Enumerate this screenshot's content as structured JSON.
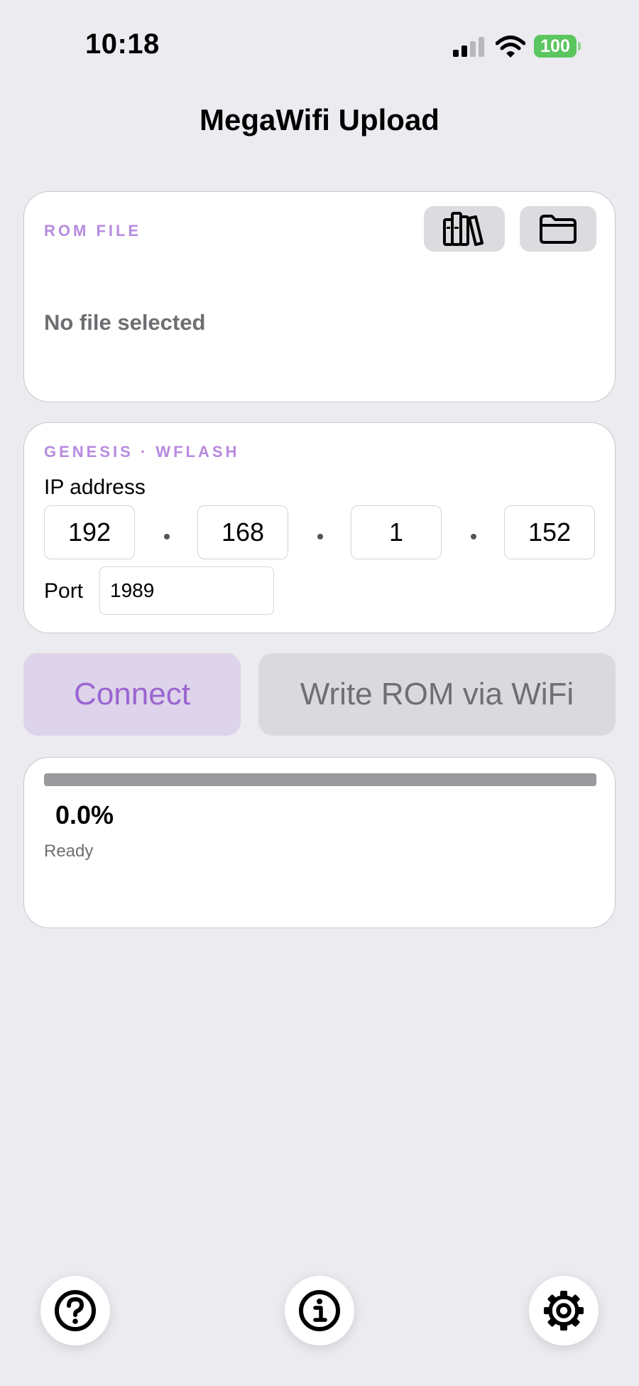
{
  "status_bar": {
    "time": "10:18",
    "battery": "100"
  },
  "nav": {
    "title": "MegaWifi Upload"
  },
  "rom_card": {
    "section_label": "ROM FILE",
    "file_status": "No file selected",
    "library_icon": "books-library-icon",
    "folder_icon": "folder-icon"
  },
  "network_card": {
    "section_label": "GENESIS · WFLASH",
    "ip_label": "IP address",
    "ip_octets": [
      "192",
      "168",
      "1",
      "152"
    ],
    "port_label": "Port",
    "port_value": "1989"
  },
  "actions": {
    "connect_label": "Connect",
    "write_label": "Write ROM via WiFi"
  },
  "progress": {
    "fraction": 0.0,
    "percent_text": "0.0%",
    "status": "Ready"
  },
  "bottom_bar": {
    "help_icon": "question-mark-icon",
    "info_icon": "info-icon",
    "settings_icon": "gear-icon"
  },
  "colors": {
    "accent": "#b78ae0",
    "connect_text": "#9a65d1",
    "connect_bg": "#ddd3ea",
    "disabled_bg": "#d9d9de",
    "background": "#ebebf0",
    "battery": "#5bc65f"
  }
}
